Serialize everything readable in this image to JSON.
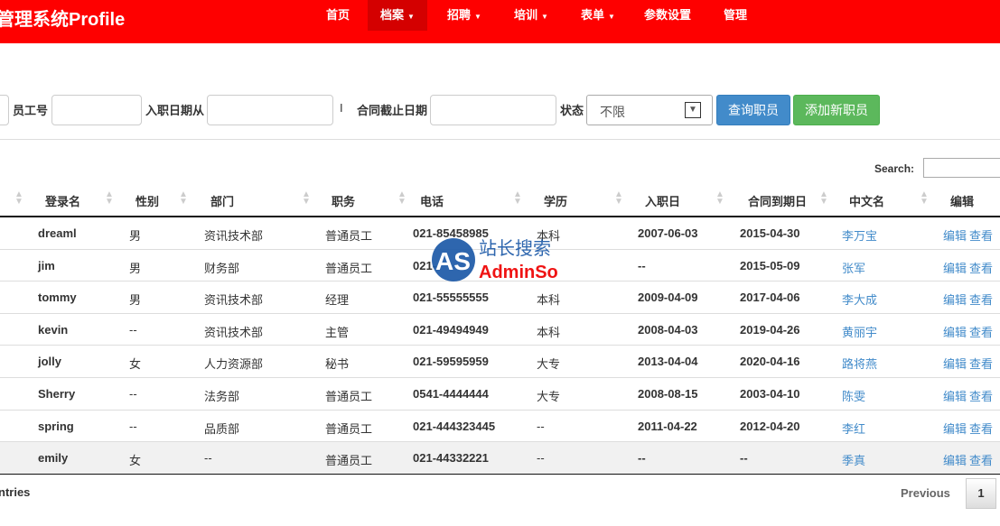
{
  "app": {
    "title": "管理系统Profile"
  },
  "nav": [
    {
      "label": "首页",
      "dropdown": false
    },
    {
      "label": "档案",
      "dropdown": true,
      "active": true
    },
    {
      "label": "招聘",
      "dropdown": true
    },
    {
      "label": "培训",
      "dropdown": true
    },
    {
      "label": "表单",
      "dropdown": true
    },
    {
      "label": "参数设置",
      "dropdown": false
    },
    {
      "label": "管理",
      "dropdown": false
    }
  ],
  "filters": {
    "employee_no_label": "员工号",
    "employee_no_value": "",
    "hire_from_label": "入职日期从",
    "hire_from_value": "",
    "range_sep": "I",
    "contract_end_label": "合同截止日期",
    "contract_end_value": "",
    "status_label": "状态",
    "status_value": "不限",
    "query_button": "查询职员",
    "add_button": "添加新职员"
  },
  "search": {
    "label": "Search:",
    "value": ""
  },
  "table": {
    "headers": [
      "登录名",
      "性别",
      "部门",
      "职务",
      "电话",
      "学历",
      "入职日",
      "合同到期日",
      "中文名",
      "编辑"
    ],
    "rows": [
      [
        "dreaml",
        "男",
        "资讯技术部",
        "普通员工",
        "021-85458985",
        "本科",
        "2007-06-03",
        "2015-04-30",
        "李万宝"
      ],
      [
        "jim",
        "男",
        "财务部",
        "普通员工",
        "021-",
        "",
        "--",
        "2015-05-09",
        "张军"
      ],
      [
        "tommy",
        "男",
        "资讯技术部",
        "经理",
        "021-55555555",
        "本科",
        "2009-04-09",
        "2017-04-06",
        "李大成"
      ],
      [
        "kevin",
        "--",
        "资讯技术部",
        "主管",
        "021-49494949",
        "本科",
        "2008-04-03",
        "2019-04-26",
        "黄丽宇"
      ],
      [
        "jolly",
        "女",
        "人力资源部",
        "秘书",
        "021-59595959",
        "大专",
        "2013-04-04",
        "2020-04-16",
        "路将燕"
      ],
      [
        "Sherry",
        "--",
        "法务部",
        "普通员工",
        "0541-4444444",
        "大专",
        "2008-08-15",
        "2003-04-10",
        "陈雯"
      ],
      [
        "spring",
        "--",
        "品质部",
        "普通员工",
        "021-444323445",
        "--",
        "2011-04-22",
        "2012-04-20",
        "李红"
      ],
      [
        "emily",
        "女",
        "--",
        "普通员工",
        "021-44332221",
        "--",
        "--",
        "--",
        "季真"
      ]
    ],
    "actions": [
      "编辑",
      "查看"
    ]
  },
  "footer": {
    "info": "ntries",
    "previous": "Previous",
    "page": "1"
  },
  "watermark": {
    "text1": "站长搜索",
    "text2": "AdminSo",
    "logo": "AS"
  },
  "colors": {
    "nav": "#fe0000",
    "primary": "#428bca",
    "success": "#5cb85c"
  }
}
